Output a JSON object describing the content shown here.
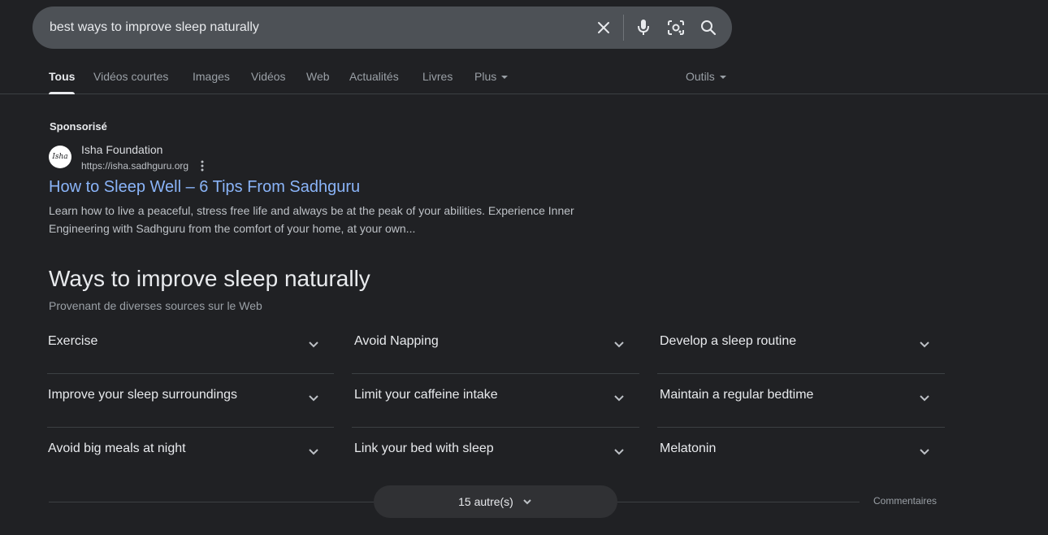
{
  "search": {
    "query": "best ways to improve sleep naturally",
    "icons": [
      "close-icon",
      "microphone-icon",
      "lens-icon",
      "search-icon"
    ]
  },
  "tabs": [
    {
      "label": "Tous",
      "active": true
    },
    {
      "label": "Vidéos courtes"
    },
    {
      "label": "Images"
    },
    {
      "label": "Vidéos"
    },
    {
      "label": "Web"
    },
    {
      "label": "Actualités"
    },
    {
      "label": "Livres"
    },
    {
      "label": "Plus"
    }
  ],
  "tools_label": "Outils",
  "ad": {
    "sponsored_label": "Sponsorisé",
    "logo_text": "Isha",
    "name": "Isha Foundation",
    "url": "https://isha.sadhguru.org",
    "title": "How to Sleep Well – 6 Tips From Sadhguru",
    "description": "Learn how to live a peaceful, stress free life and always be at the peak of your abilities. Experience Inner Engineering with Sadhguru from the comfort of your home, at your own..."
  },
  "section": {
    "title": "Ways to improve sleep naturally",
    "subtitle": "Provenant de diverses sources sur le Web"
  },
  "items": [
    [
      "Exercise",
      "Avoid Napping",
      "Develop a sleep routine"
    ],
    [
      "Improve your sleep surroundings",
      "Limit your caffeine intake",
      "Maintain a regular bedtime"
    ],
    [
      "Avoid big meals at night",
      "Link your bed with sleep",
      "Melatonin"
    ]
  ],
  "more_button": "15 autre(s)",
  "feedback": "Commentaires",
  "colors": {
    "background": "#202124",
    "link": "#8ab4f8",
    "search_bar": "#4d5156"
  }
}
